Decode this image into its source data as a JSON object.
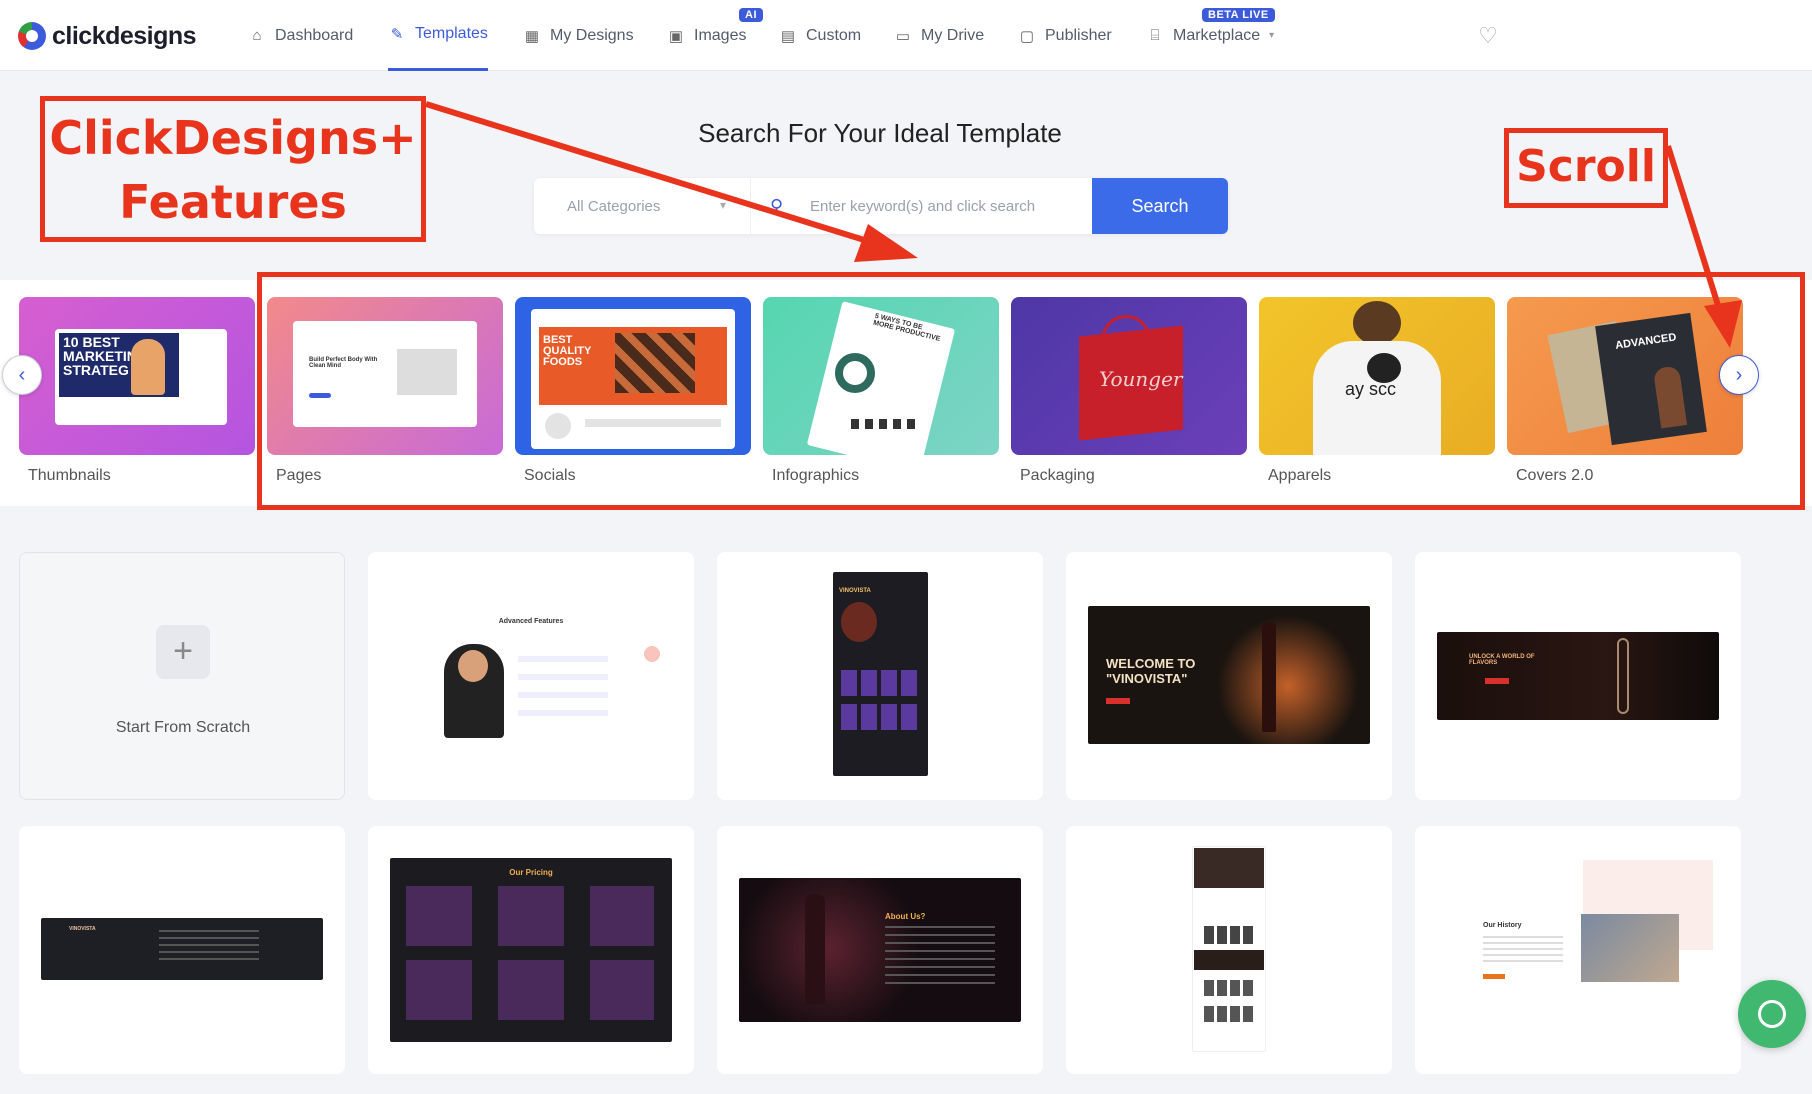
{
  "app": {
    "brand": "clickdesigns"
  },
  "nav": {
    "items": [
      {
        "label": "Dashboard",
        "icon": "home-icon"
      },
      {
        "label": "Templates",
        "icon": "edit-icon",
        "active": true
      },
      {
        "label": "My Designs",
        "icon": "grid-icon"
      },
      {
        "label": "Images",
        "icon": "image-icon",
        "badge": "AI"
      },
      {
        "label": "Custom",
        "icon": "save-icon"
      },
      {
        "label": "My Drive",
        "icon": "folder-icon"
      },
      {
        "label": "Publisher",
        "icon": "calendar-icon"
      },
      {
        "label": "Marketplace",
        "icon": "store-icon",
        "badge": "BETA LIVE",
        "dropdown": true
      }
    ]
  },
  "hero": {
    "title": "Search For Your Ideal Template",
    "category_select": "All Categories",
    "search_placeholder": "Enter keyword(s) and click search",
    "search_button": "Search"
  },
  "categories": [
    {
      "label": "Thumbnails",
      "thumb_text": "10 BEST MARKETING STRATEG"
    },
    {
      "label": "Pages",
      "thumb_text": "Build Perfect Body With Clean Mind"
    },
    {
      "label": "Socials",
      "thumb_text": "BEST QUALITY FOODS"
    },
    {
      "label": "Infographics",
      "thumb_text": "5 WAYS TO BE MORE PRODUCTIVE"
    },
    {
      "label": "Packaging",
      "thumb_text": "Younger"
    },
    {
      "label": "Apparels",
      "thumb_text": "ay scc"
    },
    {
      "label": "Covers 2.0",
      "thumb_text": "ADVANCED"
    }
  ],
  "annotations": {
    "features_label_line1": "ClickDesigns+",
    "features_label_line2": "Features",
    "scroll_label": "Scroll",
    "accent": "#e8341c"
  },
  "templates": {
    "scratch_label": "Start From Scratch",
    "cards": [
      {
        "caption": "Advanced Features"
      },
      {
        "caption": "VINOVISTA"
      },
      {
        "caption": "WELCOME TO \"VINOVISTA\""
      },
      {
        "caption": "UNLOCK A WORLD OF FLAVORS"
      },
      {
        "caption": "VINOVISTA"
      },
      {
        "caption": "Our Pricing"
      },
      {
        "caption": "About Us?"
      },
      {
        "caption": ""
      },
      {
        "caption": "Our History"
      }
    ]
  },
  "colors": {
    "primary": "#3b5bdb",
    "button": "#3b6be8",
    "chat": "#40b870"
  }
}
